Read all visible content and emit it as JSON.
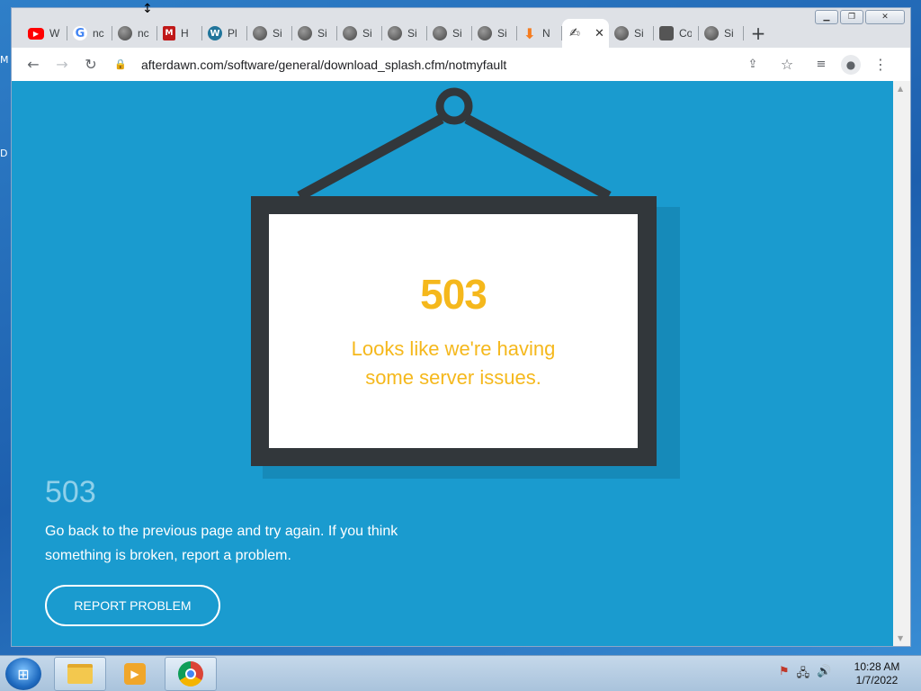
{
  "desktop": {
    "fragment_top": "M",
    "fragment_mid": "D"
  },
  "browser": {
    "tabs": [
      {
        "icon": "youtube-icon",
        "label": "W"
      },
      {
        "icon": "google-icon",
        "label": "nc"
      },
      {
        "icon": "globe-icon",
        "label": "nc"
      },
      {
        "icon": "mcafee-icon",
        "label": "H"
      },
      {
        "icon": "wordpress-icon",
        "label": "Pl"
      },
      {
        "icon": "globe-icon",
        "label": "Si"
      },
      {
        "icon": "globe-icon",
        "label": "Si"
      },
      {
        "icon": "globe-icon",
        "label": "Si"
      },
      {
        "icon": "globe-icon",
        "label": "Si"
      },
      {
        "icon": "globe-icon",
        "label": "Si"
      },
      {
        "icon": "globe-icon",
        "label": "Si"
      },
      {
        "icon": "download-icon",
        "label": "N"
      },
      {
        "icon": "afterdawn-icon",
        "label": ""
      },
      {
        "icon": "globe-icon",
        "label": "Si"
      },
      {
        "icon": "shield-icon",
        "label": "Co"
      },
      {
        "icon": "globe-icon",
        "label": "Si"
      }
    ],
    "active_tab_index": 12,
    "new_tab_symbol": "+",
    "url": "afterdawn.com/software/general/download_splash.cfm/notmyfault"
  },
  "page": {
    "sign_code": "503",
    "sign_message_line1": "Looks like we're having",
    "sign_message_line2": "some server issues.",
    "error_code": "503",
    "error_message_line1": "Go back to the previous page and try again. If you think",
    "error_message_line2": "something is broken, report a problem.",
    "report_button": "REPORT PROBLEM",
    "colors": {
      "background": "#1a9bcf",
      "accent": "#f5b81c",
      "frame": "#32373b"
    }
  },
  "taskbar": {
    "time": "10:28 AM",
    "date": "1/7/2022"
  }
}
